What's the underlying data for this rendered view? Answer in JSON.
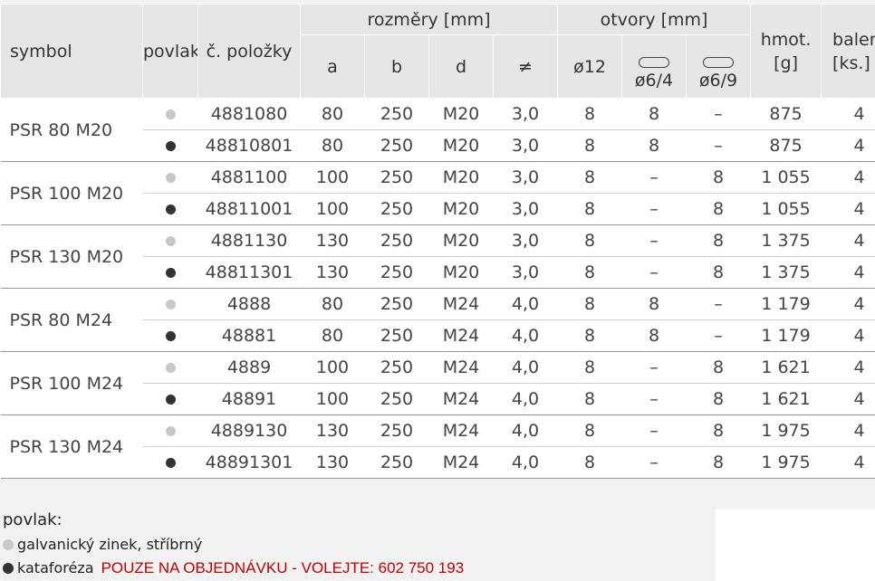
{
  "headers": {
    "symbol": "symbol",
    "povlak": "povlak",
    "polozka": "č. položky",
    "rozmery": "rozměry [mm]",
    "otvory": "otvory [mm]",
    "hmot": "hmot. [g]",
    "baleni": "balení [ks.]",
    "a": "a",
    "b": "b",
    "d": "d",
    "neq": "≠",
    "o12": "ø12",
    "o64": "ø6/4",
    "o69": "ø6/9"
  },
  "groups": [
    {
      "symbol": "PSR 80 M20",
      "rows": [
        {
          "povlak": "light",
          "polozka": "4881080",
          "a": "80",
          "b": "250",
          "d": "M20",
          "neq": "3,0",
          "o12": "8",
          "o64": "8",
          "o69": "–",
          "hmot": "875",
          "baleni": "4"
        },
        {
          "povlak": "dark",
          "polozka": "48810801",
          "a": "80",
          "b": "250",
          "d": "M20",
          "neq": "3,0",
          "o12": "8",
          "o64": "8",
          "o69": "–",
          "hmot": "875",
          "baleni": "4"
        }
      ]
    },
    {
      "symbol": "PSR 100 M20",
      "rows": [
        {
          "povlak": "light",
          "polozka": "4881100",
          "a": "100",
          "b": "250",
          "d": "M20",
          "neq": "3,0",
          "o12": "8",
          "o64": "–",
          "o69": "8",
          "hmot": "1 055",
          "baleni": "4"
        },
        {
          "povlak": "dark",
          "polozka": "48811001",
          "a": "100",
          "b": "250",
          "d": "M20",
          "neq": "3,0",
          "o12": "8",
          "o64": "–",
          "o69": "8",
          "hmot": "1 055",
          "baleni": "4"
        }
      ]
    },
    {
      "symbol": "PSR 130 M20",
      "rows": [
        {
          "povlak": "light",
          "polozka": "4881130",
          "a": "130",
          "b": "250",
          "d": "M20",
          "neq": "3,0",
          "o12": "8",
          "o64": "–",
          "o69": "8",
          "hmot": "1 375",
          "baleni": "4"
        },
        {
          "povlak": "dark",
          "polozka": "48811301",
          "a": "130",
          "b": "250",
          "d": "M20",
          "neq": "3,0",
          "o12": "8",
          "o64": "–",
          "o69": "8",
          "hmot": "1 375",
          "baleni": "4"
        }
      ]
    },
    {
      "symbol": "PSR 80 M24",
      "rows": [
        {
          "povlak": "light",
          "polozka": "4888",
          "a": "80",
          "b": "250",
          "d": "M24",
          "neq": "4,0",
          "o12": "8",
          "o64": "8",
          "o69": "–",
          "hmot": "1 179",
          "baleni": "4"
        },
        {
          "povlak": "dark",
          "polozka": "48881",
          "a": "80",
          "b": "250",
          "d": "M24",
          "neq": "4,0",
          "o12": "8",
          "o64": "8",
          "o69": "–",
          "hmot": "1 179",
          "baleni": "4"
        }
      ]
    },
    {
      "symbol": "PSR 100 M24",
      "rows": [
        {
          "povlak": "light",
          "polozka": "4889",
          "a": "100",
          "b": "250",
          "d": "M24",
          "neq": "4,0",
          "o12": "8",
          "o64": "–",
          "o69": "8",
          "hmot": "1 621",
          "baleni": "4"
        },
        {
          "povlak": "dark",
          "polozka": "48891",
          "a": "100",
          "b": "250",
          "d": "M24",
          "neq": "4,0",
          "o12": "8",
          "o64": "–",
          "o69": "8",
          "hmot": "1 621",
          "baleni": "4"
        }
      ]
    },
    {
      "symbol": "PSR 130 M24",
      "rows": [
        {
          "povlak": "light",
          "polozka": "4889130",
          "a": "130",
          "b": "250",
          "d": "M24",
          "neq": "4,0",
          "o12": "8",
          "o64": "–",
          "o69": "8",
          "hmot": "1 975",
          "baleni": "4"
        },
        {
          "povlak": "dark",
          "polozka": "48891301",
          "a": "130",
          "b": "250",
          "d": "M24",
          "neq": "4,0",
          "o12": "8",
          "o64": "–",
          "o69": "8",
          "hmot": "1 975",
          "baleni": "4"
        }
      ]
    }
  ],
  "legend": {
    "title": "povlak:",
    "light_label": "galvanický zinek, stříbrný",
    "dark_label": "kataforéza",
    "note": "POUZE NA OBJEDNÁVKU - VOLEJTE: 602 750 193"
  },
  "colors": {
    "light_dot": "#c8c8c8",
    "dark_dot": "#333333",
    "note_red": "#c00000",
    "header_bg": "#e6e6e6"
  }
}
